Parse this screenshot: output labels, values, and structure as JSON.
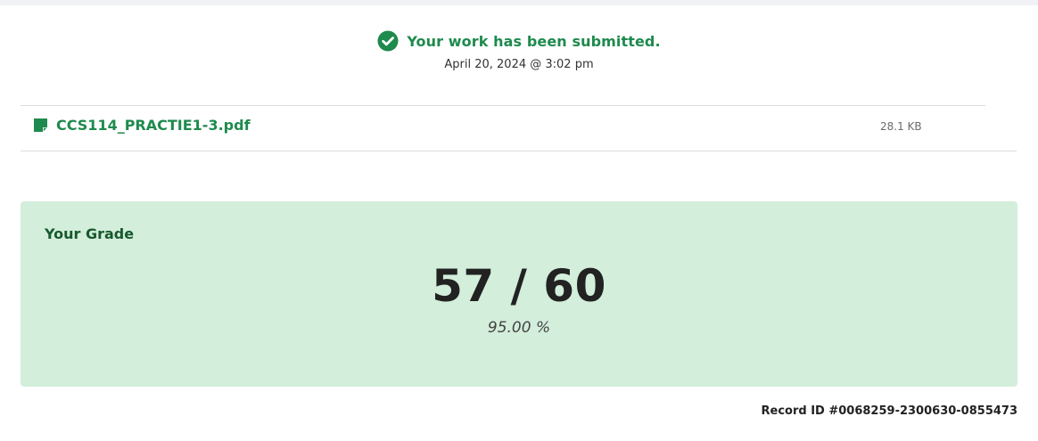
{
  "submission": {
    "title": "Your work has been submitted.",
    "date": "April 20, 2024 @ 3:02 pm",
    "status_icon": "check-circle-icon"
  },
  "file": {
    "name": "CCS114_PRACTIE1-3.pdf",
    "size": "28.1 KB",
    "icon": "file-icon"
  },
  "grade": {
    "label": "Your Grade",
    "score": "57 / 60",
    "percent": "95.00 %"
  },
  "record": {
    "id_text": "Record ID #0068259-2300630-0855473"
  },
  "colors": {
    "accent_green": "#1e8a4d",
    "grade_background": "#d3eedb",
    "grade_label": "#175a2c"
  }
}
